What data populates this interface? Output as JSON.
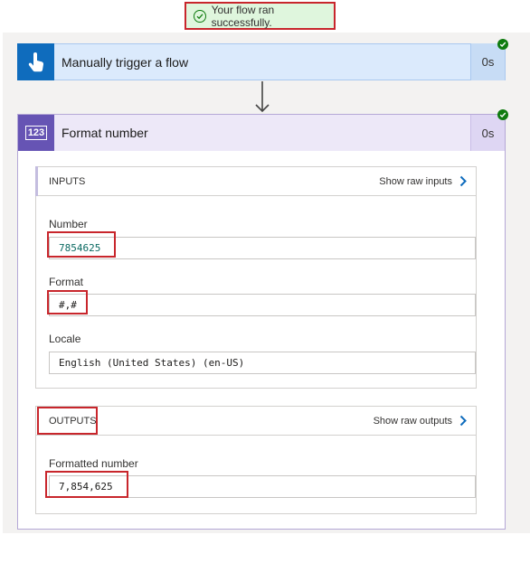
{
  "banner": {
    "message": "Your flow ran successfully.",
    "status_color": "#107c10"
  },
  "trigger": {
    "title": "Manually trigger a flow",
    "duration": "0s",
    "accent_color": "#0f6cbd"
  },
  "action": {
    "icon_text": "123",
    "title": "Format number",
    "duration": "0s",
    "accent_color": "#6654b4",
    "inputs": {
      "heading": "INPUTS",
      "raw_link": "Show raw inputs",
      "fields": [
        {
          "label": "Number",
          "value": "7854625"
        },
        {
          "label": "Format",
          "value": "#,#"
        },
        {
          "label": "Locale",
          "value": "English (United States) (en-US)"
        }
      ]
    },
    "outputs": {
      "heading": "OUTPUTS",
      "raw_link": "Show raw outputs",
      "fields": [
        {
          "label": "Formatted number",
          "value": "7,854,625"
        }
      ]
    }
  },
  "icons": [
    "success-check-icon",
    "touch-hand-icon",
    "down-arrow-icon",
    "chevron-right-icon"
  ]
}
